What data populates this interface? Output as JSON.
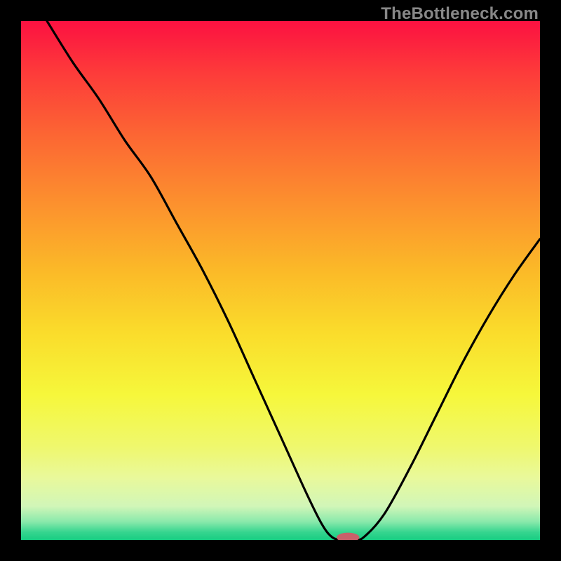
{
  "watermark": {
    "text": "TheBottleneck.com"
  },
  "chart_data": {
    "type": "line",
    "title": "",
    "xlabel": "",
    "ylabel": "",
    "xlim": [
      0,
      100
    ],
    "ylim": [
      0,
      100
    ],
    "series": [
      {
        "name": "curve",
        "x": [
          5,
          10,
          15,
          20,
          25,
          30,
          35,
          40,
          45,
          50,
          55,
          58,
          60,
          62,
          64,
          66,
          70,
          75,
          80,
          85,
          90,
          95,
          100
        ],
        "y": [
          100,
          92,
          85,
          77,
          70,
          61,
          52,
          42,
          31,
          20,
          9,
          3,
          0.5,
          0,
          0,
          0.5,
          5,
          14,
          24,
          34,
          43,
          51,
          58
        ]
      }
    ],
    "marker": {
      "x": 63,
      "y": 0.5,
      "rx": 2.2,
      "ry": 0.9,
      "color": "#c9606a"
    },
    "gradient_stops": [
      {
        "offset": 0.0,
        "color": "#fc1141"
      },
      {
        "offset": 0.1,
        "color": "#fd3b3a"
      },
      {
        "offset": 0.22,
        "color": "#fc6633"
      },
      {
        "offset": 0.35,
        "color": "#fc902e"
      },
      {
        "offset": 0.48,
        "color": "#fbb928"
      },
      {
        "offset": 0.6,
        "color": "#fadc2b"
      },
      {
        "offset": 0.72,
        "color": "#f6f73b"
      },
      {
        "offset": 0.82,
        "color": "#eff86d"
      },
      {
        "offset": 0.88,
        "color": "#e9f99b"
      },
      {
        "offset": 0.935,
        "color": "#d1f6b8"
      },
      {
        "offset": 0.965,
        "color": "#89e9ab"
      },
      {
        "offset": 0.985,
        "color": "#36d58f"
      },
      {
        "offset": 1.0,
        "color": "#17cd82"
      }
    ]
  }
}
